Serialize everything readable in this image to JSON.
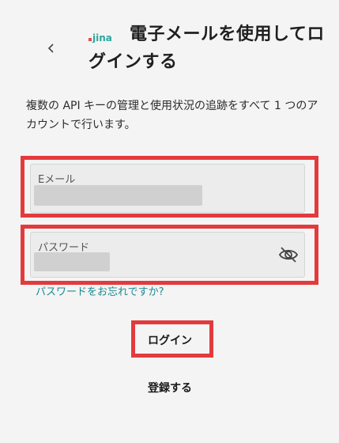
{
  "header": {
    "back_icon": "chevron-left-icon",
    "logo_icon": "jina-logo-icon",
    "title": "電子メールを使用してログインする"
  },
  "description": "複数の API キーの管理と使用状況の追跡をすべて 1 つのアカウントで行います。",
  "form": {
    "email": {
      "label": "Eメール"
    },
    "password": {
      "label": "パスワード",
      "toggle_icon": "eye-off-icon"
    },
    "forgot_link": "パスワードをお忘れですか?"
  },
  "actions": {
    "login_label": "ログイン",
    "register_label": "登録する"
  },
  "colors": {
    "background": "#f4f4f4",
    "highlight": "#e33a3d",
    "link": "#1c8a8f",
    "logo_red": "#e2504a",
    "logo_teal": "#2aa8a0"
  }
}
